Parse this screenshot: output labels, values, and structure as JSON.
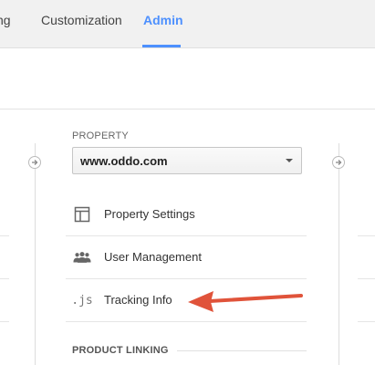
{
  "nav": {
    "tabs": [
      {
        "label": "ng",
        "active": false
      },
      {
        "label": "Customization",
        "active": false
      },
      {
        "label": "Admin",
        "active": true
      }
    ],
    "accent_color": "#4d90fe"
  },
  "property_column": {
    "heading": "PROPERTY",
    "selected_property": "www.oddo.com",
    "items": [
      {
        "label": "Property Settings",
        "icon": "property-settings-icon"
      },
      {
        "label": "User Management",
        "icon": "users-icon"
      },
      {
        "label": "Tracking Info",
        "icon": "js-icon",
        "icon_text": ".js"
      }
    ],
    "section_heading": "PRODUCT LINKING"
  },
  "annotation": {
    "arrow_color": "#e0533a",
    "points_to": "Tracking Info"
  }
}
